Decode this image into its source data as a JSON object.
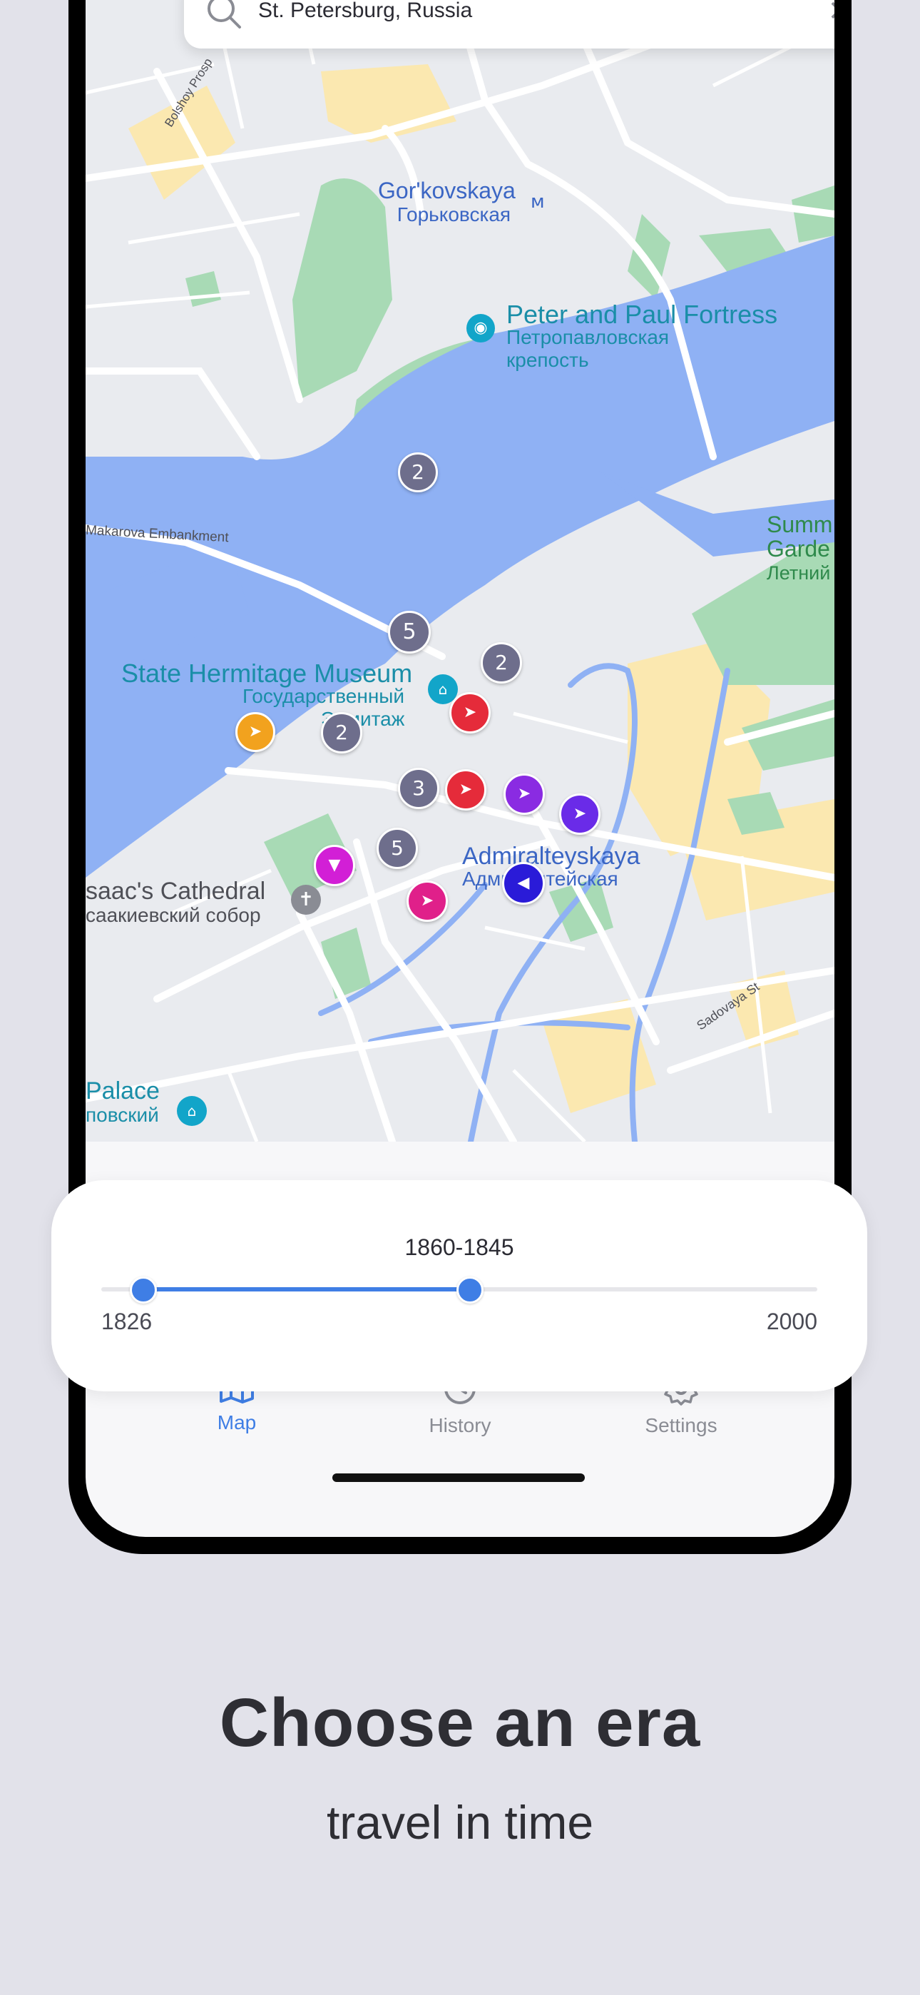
{
  "search": {
    "value": "St. Petersburg, Russia",
    "clear_icon": "close-icon"
  },
  "map": {
    "labels": {
      "gorkovskaya_en": "Gor'kovskaya",
      "gorkovskaya_ru": "Горьковская",
      "fortress_en": "Peter and Paul Fortress",
      "fortress_ru_1": "Петропавловская",
      "fortress_ru_2": "крепость",
      "makarova": "Makarova Embankment",
      "hermitage_en": "State Hermitage Museum",
      "hermitage_ru_1": "Государственный",
      "hermitage_ru_2": "Эрмитаж",
      "admiralteyskaya_en": "Admiralteyskaya",
      "admiralteyskaya_ru": "Адмиралтейская",
      "isaac_en": "saac's Cathedral",
      "isaac_ru": "саакиевский собор",
      "summer_1": "Summ",
      "summer_2": "Garde",
      "summer_ru": "Летний",
      "palace_en": "Palace",
      "palace_ru": "повский",
      "bolshoy": "Bolshoy Prosp",
      "sadovaya": "Sadovaya St"
    },
    "clusters": [
      "2",
      "5",
      "2",
      "2",
      "3",
      "5"
    ],
    "pin_colors": [
      "#f2a21e",
      "#e52b3a",
      "#e52b3a",
      "#8a2be2",
      "#6a2be8",
      "#d21fd6",
      "#e0208a",
      "#2a1bd8"
    ]
  },
  "slider": {
    "range_label": "1860-1845",
    "min_label": "1826",
    "max_label": "2000",
    "min_value": 1826,
    "max_value": 2000,
    "low_fraction": 0.0,
    "high_fraction": 0.46
  },
  "tabs": [
    {
      "label": "Map",
      "icon": "map-icon",
      "active": true
    },
    {
      "label": "History",
      "icon": "history-icon",
      "active": false
    },
    {
      "label": "Settings",
      "icon": "gear-icon",
      "active": false
    }
  ],
  "promo": {
    "headline": "Choose an era",
    "subline": "travel in time"
  },
  "colors": {
    "accent": "#3f7ee5",
    "water": "#8fb1f4",
    "park": "#a8dab5",
    "cluster": "#6e6e8c",
    "inactive": "#8a8c94"
  }
}
